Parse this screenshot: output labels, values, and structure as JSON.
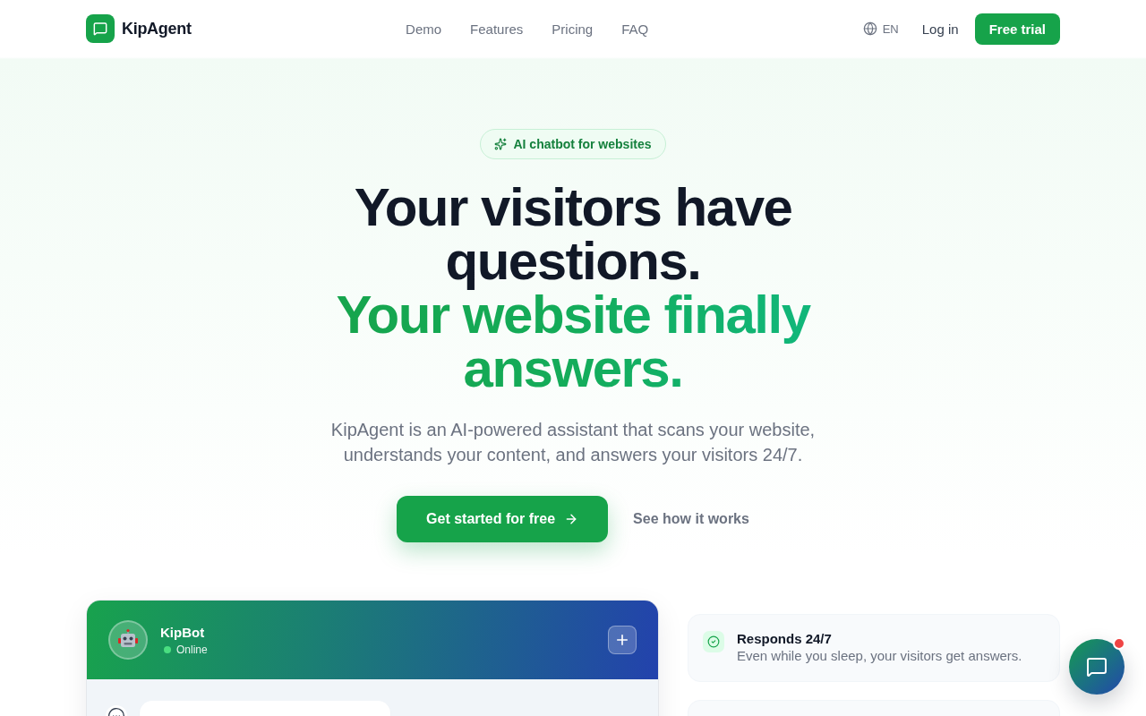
{
  "header": {
    "brand": "KipAgent",
    "nav": [
      {
        "label": "Demo"
      },
      {
        "label": "Features"
      },
      {
        "label": "Pricing"
      },
      {
        "label": "FAQ"
      }
    ],
    "language": "EN",
    "login": "Log in",
    "cta": "Free trial"
  },
  "hero": {
    "badge": "AI chatbot for websites",
    "headline": [
      {
        "text": "Your visitors have questions.",
        "kind": "plain"
      },
      {
        "text": "Your website finally answers.",
        "kind": "accent"
      }
    ],
    "subtitle": "KipAgent is an AI-powered assistant that scans your website, understands your content, and answers your visitors 24/7.",
    "primary_button": "Get started for free",
    "secondary_link": "See how it works"
  },
  "chat_preview": {
    "bot_name": "KipBot",
    "status": "Online",
    "online": true
  },
  "features": [
    {
      "title": "Responds 24/7",
      "description": "Even while you sleep, your visitors get answers."
    }
  ],
  "chat_launcher": {
    "unread": true
  }
}
